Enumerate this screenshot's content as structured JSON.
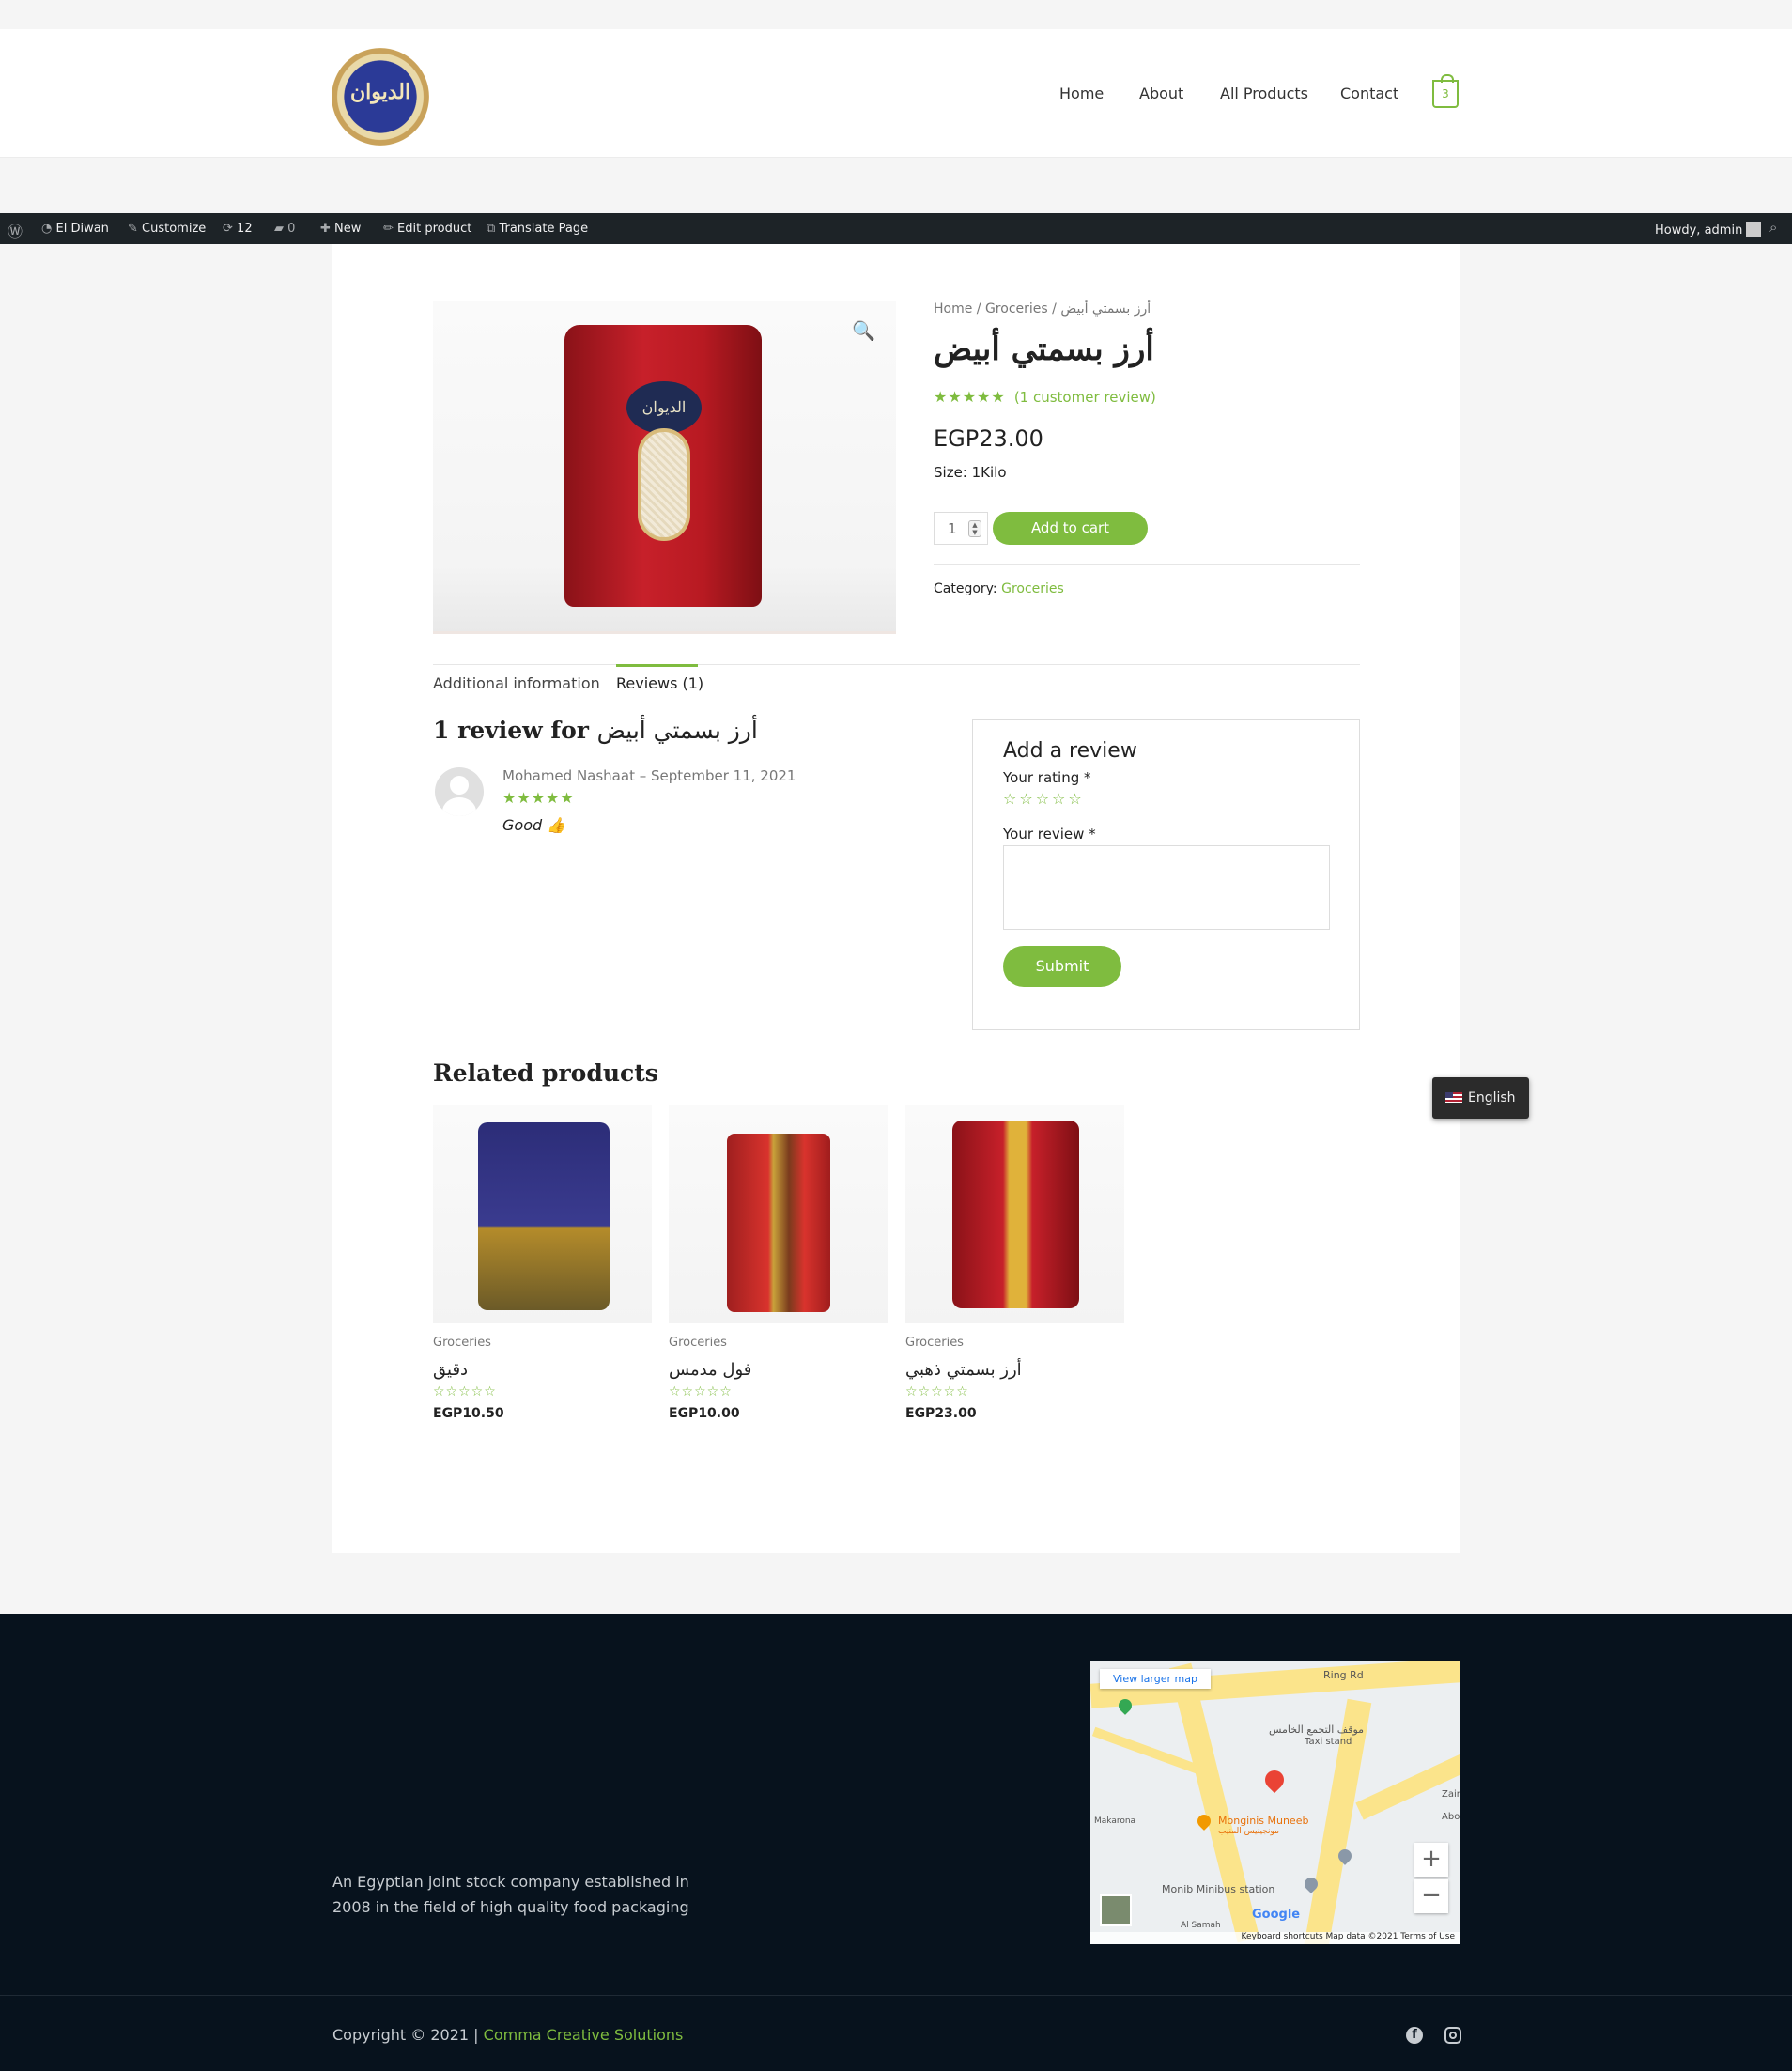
{
  "header": {
    "logo_text": "الديوان",
    "nav": [
      "Home",
      "About",
      "All Products",
      "Contact"
    ],
    "cart_count": "3"
  },
  "admin_bar": {
    "site_name": "El Diwan",
    "customize": "Customize",
    "updates": "12",
    "comments": "0",
    "new": "New",
    "edit_product": "Edit product",
    "translate": "Translate Page",
    "howdy": "Howdy, admin"
  },
  "product": {
    "breadcrumb": "Home / Groceries / أرز بسمتي أبيض",
    "title": "أرز بسمتي أبيض",
    "rating": 5,
    "rating_stars": "★★★★★",
    "review_link": "(1 customer review)",
    "price": "EGP23.00",
    "size": "Size: 1Kilo",
    "quantity": "1",
    "add_to_cart": "Add to cart",
    "category_label": "Category:",
    "category": "Groceries"
  },
  "tabs": [
    "Additional information",
    "Reviews (1)"
  ],
  "reviews": {
    "heading_prefix": "1 review for",
    "heading_product": "أرز بسمتي أبيض",
    "items": [
      {
        "author_date": "Mohamed Nashaat – September 11, 2021",
        "stars": "★★★★★",
        "text": "Good 👍"
      }
    ]
  },
  "review_form": {
    "title": "Add a review",
    "rating_label": "Your rating *",
    "rating_stars": "☆☆☆☆☆",
    "review_label": "Your review *",
    "submit": "Submit"
  },
  "related": {
    "heading": "Related products",
    "items": [
      {
        "category": "Groceries",
        "name": "دقيق",
        "stars": "☆☆☆☆☆",
        "price": "EGP10.50"
      },
      {
        "category": "Groceries",
        "name": "فول مدمس",
        "stars": "☆☆☆☆☆",
        "price": "EGP10.00"
      },
      {
        "category": "Groceries",
        "name": "أرز بسمتي ذهبي",
        "stars": "☆☆☆☆☆",
        "price": "EGP23.00"
      }
    ]
  },
  "language_switcher": "English",
  "map": {
    "view_larger": "View larger map",
    "labels": [
      "Ring Rd",
      "موقف التجمع الخامس",
      "Taxi stand",
      "Makarona",
      "Monginis Muneeb",
      "مونجينيس المنيب",
      "Monib Minibus station",
      "Al Samah",
      "Zain",
      "Abo"
    ],
    "footer": "Keyboard shortcuts   Map data ©2021   Terms of Use",
    "google": "Google"
  },
  "footer": {
    "about": "An Egyptian joint stock company established in 2008 in the field of high quality food packaging",
    "copyright_prefix": "Copyright © 2021 | ",
    "copyright_link": "Comma Creative Solutions"
  },
  "colors": {
    "accent": "#7fbc3f",
    "admin_bar": "#1d2327",
    "footer_bg": "#07121d"
  }
}
